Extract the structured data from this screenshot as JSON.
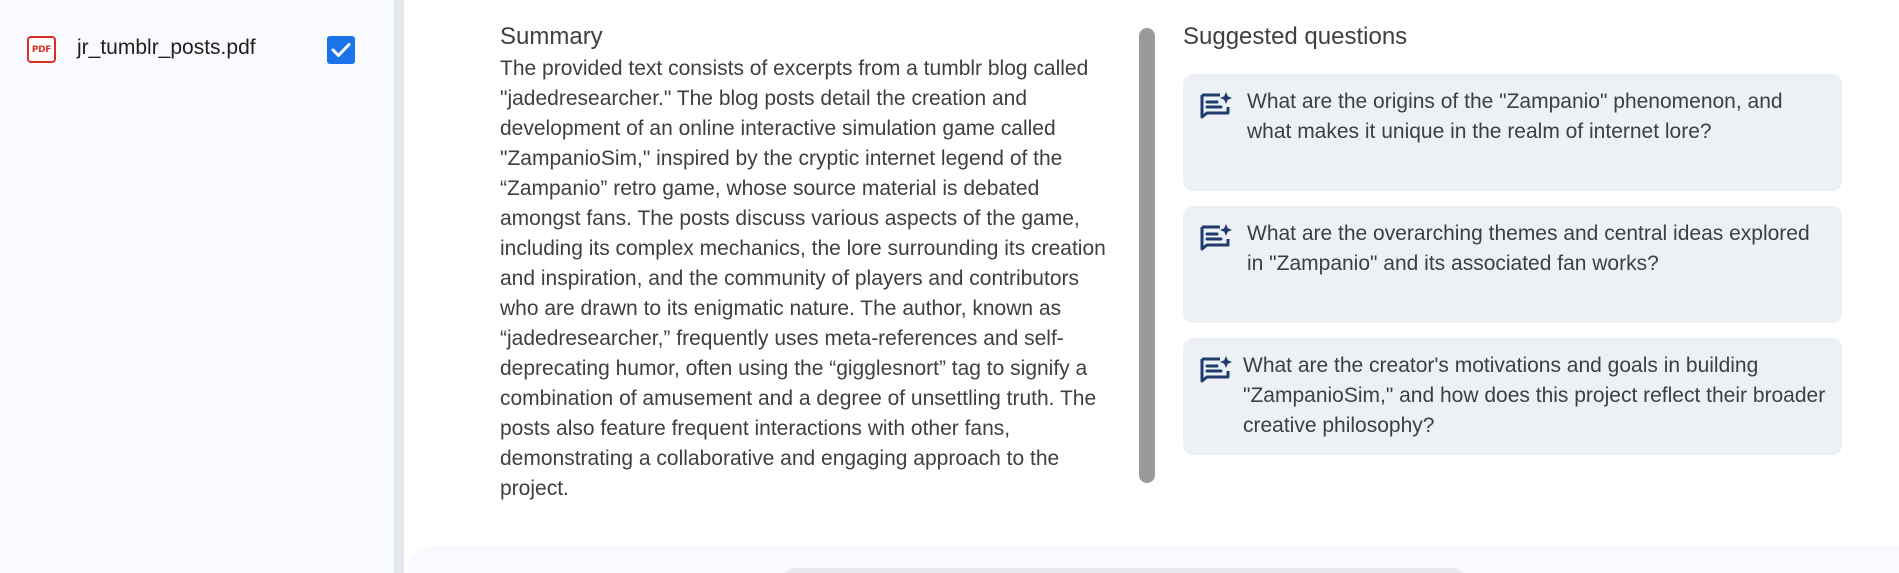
{
  "sidebar": {
    "sources": [
      {
        "type_icon": "pdf-icon",
        "icon_text": "PDF",
        "name": "jr_tumblr_posts.pdf",
        "checked": true
      }
    ]
  },
  "summary": {
    "heading": "Summary",
    "body": "The provided text consists of excerpts from a tumblr blog called \"jadedresearcher.\" The blog posts detail the creation and development of an online interactive simulation game called \"ZampanioSim,\" inspired by the cryptic internet legend of the “Zampanio” retro game, whose source material is debated amongst fans. The posts discuss various aspects of the game, including its complex mechanics, the lore surrounding its creation and inspiration, and the community of players and contributors who are drawn to its enigmatic nature. The author, known as “jadedresearcher,” frequently uses meta-references and self-deprecating humor, often using the “gigglesnort” tag to signify a combination of amusement and a degree of unsettling truth. The posts also feature frequent interactions with other fans, demonstrating a collaborative and engaging approach to the project."
  },
  "suggested": {
    "heading": "Suggested questions",
    "questions": [
      "What are the origins of the \"Zampanio\" phenomenon, and what makes it unique in the realm of internet lore?",
      "What are the overarching themes and central ideas explored in \"Zampanio\" and its associated fan works?",
      "What are the creator's motivations and goals in building \"ZampanioSim,\" and how does this project reflect their broader creative philosophy?"
    ],
    "icon": "question-sparkle-icon"
  },
  "colors": {
    "accent": "#1a73e8",
    "pdf_red": "#d93025",
    "card_bg": "#edf0f4",
    "sidebar_bg": "#f8fafd",
    "text": "#3c4043"
  }
}
